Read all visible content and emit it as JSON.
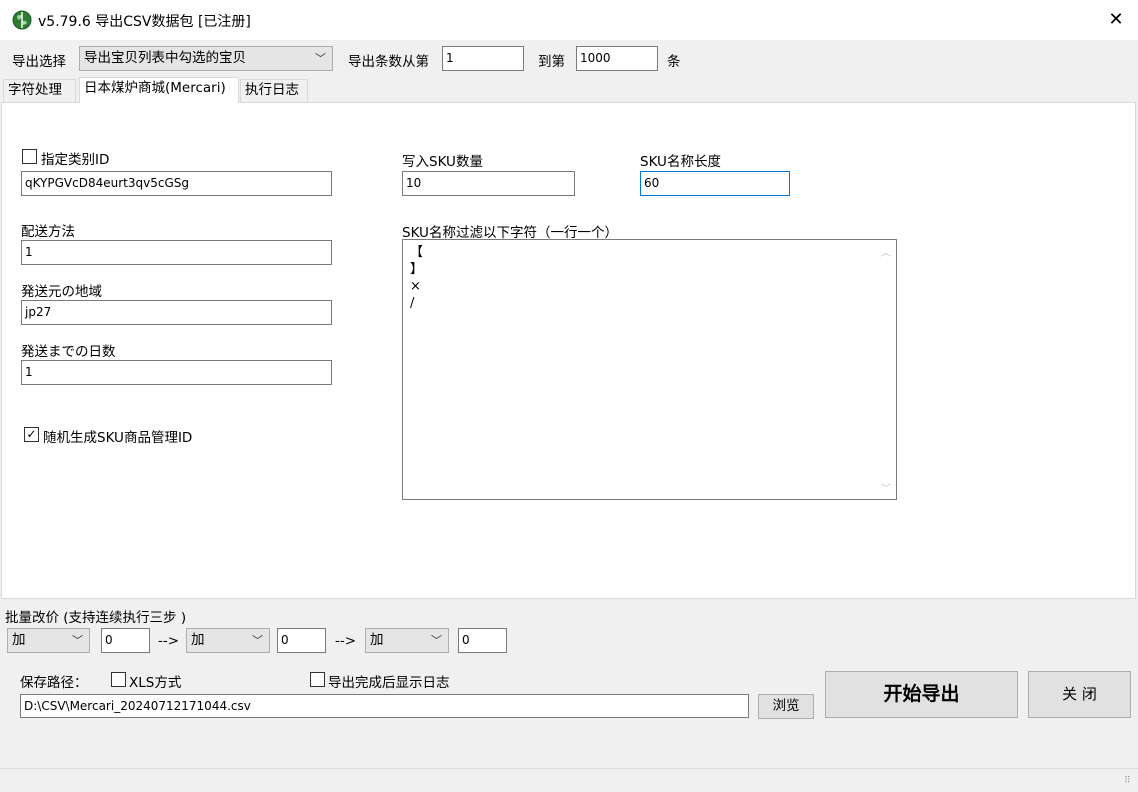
{
  "window": {
    "title": "v5.79.6  导出CSV数据包 [已注册]",
    "close_label": "✕"
  },
  "export": {
    "select_label": "导出选择",
    "select_value": "导出宝贝列表中勾选的宝贝",
    "count_from_label": "导出条数从第",
    "count_from_value": "1",
    "count_to_label": "到第",
    "count_to_value": "1000",
    "count_unit": "条"
  },
  "tabs": [
    {
      "label": "字符处理"
    },
    {
      "label": "日本煤炉商城(Mercari)"
    },
    {
      "label": "执行日志"
    }
  ],
  "mercari": {
    "category_id_label": "指定类别ID",
    "category_id_checked": false,
    "category_id_value": "qKYPGVcD84eurt3qv5cGSg",
    "shipping_method_label": "配送方法",
    "shipping_method_value": "1",
    "ship_from_label": "発送元の地域",
    "ship_from_value": "jp27",
    "days_to_ship_label": "発送までの日数",
    "days_to_ship_value": "1",
    "random_sku_label": "随机生成SKU商品管理ID",
    "random_sku_checked": true,
    "sku_count_label": "写入SKU数量",
    "sku_count_value": "10",
    "sku_name_len_label": "SKU名称长度",
    "sku_name_len_value": "60",
    "sku_filter_label": "SKU名称过滤以下字符（一行一个）",
    "sku_filter_lines": [
      "【",
      "】",
      "×",
      "/"
    ]
  },
  "price": {
    "label": "批量改价 (支持连续执行三步 )",
    "steps": [
      {
        "op": "加",
        "value": "0"
      },
      {
        "op": "加",
        "value": "0"
      },
      {
        "op": "加",
        "value": "0"
      }
    ],
    "arrow": "-->"
  },
  "save": {
    "path_label": "保存路径：",
    "xls_label": "XLS方式",
    "xls_checked": false,
    "show_log_label": "导出完成后显示日志",
    "show_log_checked": false,
    "path_value": "D:\\CSV\\Mercari_20240712171044.csv",
    "browse_label": "浏览",
    "start_label": "开始导出",
    "close_label": "关 闭"
  }
}
